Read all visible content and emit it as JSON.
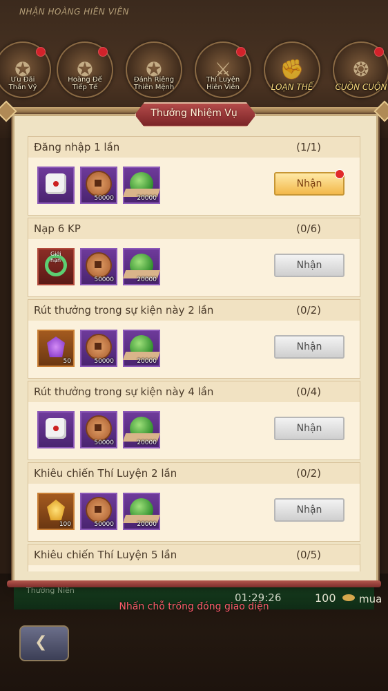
{
  "background": {
    "title": "NHẬN HOÀNG HIÊN VIÊN",
    "events": [
      {
        "label": "Ưu Đãi\nThần Vỹ",
        "has_dot": true
      },
      {
        "label": "Hoàng Đế\nTiếp Tế",
        "has_dot": true
      },
      {
        "label": "Đánh Riêng\nThiên Mệnh",
        "has_dot": false
      },
      {
        "label": "Thí Luyện\nHiên Viên",
        "has_dot": true
      },
      {
        "label": "LOẠN THẾ",
        "has_dot": false
      },
      {
        "label": "CUỒN CUỘN",
        "has_dot": true
      }
    ],
    "bottom_label": "Thường Niên",
    "timer": "01:29:26",
    "count": "100",
    "buy": "mua"
  },
  "modal": {
    "title": "Thưởng Nhiệm Vụ",
    "claim_label": "Nhận",
    "tasks": [
      {
        "name": "Đăng nhập 1 lần",
        "progress": "(1/1)",
        "claimable": true,
        "rewards": [
          {
            "icon": "dice-icon",
            "count": ""
          },
          {
            "icon": "coin-icon",
            "count": "50000"
          },
          {
            "icon": "jade-icon",
            "count": "20000"
          }
        ]
      },
      {
        "name": "Nạp 6 KP",
        "progress": "(0/6)",
        "claimable": false,
        "rewards": [
          {
            "icon": "limited-ring-icon",
            "count": "",
            "tag": "Giới hạn"
          },
          {
            "icon": "coin-icon",
            "count": "50000"
          },
          {
            "icon": "jade-icon",
            "count": "20000"
          }
        ]
      },
      {
        "name": "Rút thưởng trong sự kiện này 2 lần",
        "progress": "(0/2)",
        "claimable": false,
        "rewards": [
          {
            "icon": "purple-gem-icon",
            "count": "50"
          },
          {
            "icon": "coin-icon",
            "count": "50000"
          },
          {
            "icon": "jade-icon",
            "count": "20000"
          }
        ]
      },
      {
        "name": "Rút thưởng trong sự kiện này 4 lần",
        "progress": "(0/4)",
        "claimable": false,
        "rewards": [
          {
            "icon": "dice-icon",
            "count": ""
          },
          {
            "icon": "coin-icon",
            "count": "50000"
          },
          {
            "icon": "jade-icon",
            "count": "20000"
          }
        ]
      },
      {
        "name": "Khiêu chiến Thí Luyện 2 lần",
        "progress": "(0/2)",
        "claimable": false,
        "rewards": [
          {
            "icon": "yellow-gem-icon",
            "count": "100"
          },
          {
            "icon": "coin-icon",
            "count": "50000"
          },
          {
            "icon": "jade-icon",
            "count": "20000"
          }
        ]
      },
      {
        "name": "Khiêu chiến Thí Luyện 5 lần",
        "progress": "(0/5)",
        "claimable": false,
        "rewards": []
      }
    ]
  },
  "hint": "Nhấn chỗ trống đóng giao diện"
}
